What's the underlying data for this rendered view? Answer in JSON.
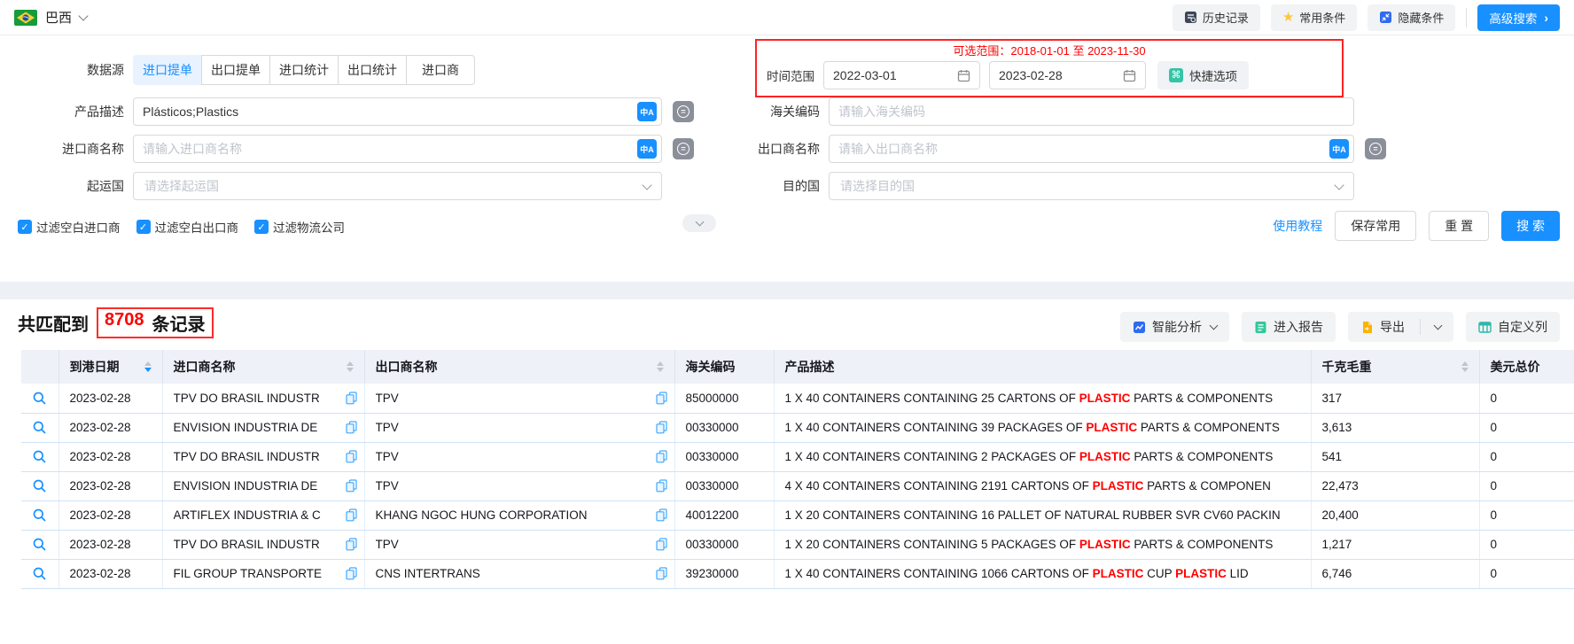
{
  "colors": {
    "accent": "#1890ff",
    "danger": "#ff0000",
    "highlight": "#ff0000",
    "success": "#34c79a",
    "warning": "#ffb200"
  },
  "topbar": {
    "country": "巴西",
    "buttons": [
      {
        "name": "history-button",
        "label": "历史记录",
        "icon": "history-icon"
      },
      {
        "name": "favorite-conditions-button",
        "label": "常用条件",
        "icon": "star-icon"
      },
      {
        "name": "hide-conditions-button",
        "label": "隐藏条件",
        "icon": "hide-icon"
      },
      {
        "name": "advanced-search-button",
        "label": "高级搜索",
        "icon": null,
        "primary": true,
        "chevron": true,
        "divider_before": true
      }
    ]
  },
  "search": {
    "datasource_label": "数据源",
    "tabs": [
      {
        "label": "进口提单",
        "active": true
      },
      {
        "label": "出口提单",
        "active": false
      },
      {
        "label": "进口统计",
        "active": false
      },
      {
        "label": "出口统计",
        "active": false
      },
      {
        "label": "进口商",
        "active": false
      }
    ],
    "time_range": {
      "hint": "可选范围：2018-01-01 至 2023-11-30",
      "label": "时间范围",
      "start": "2022-03-01",
      "end": "2023-02-28",
      "quick_button": "快捷选项"
    },
    "fields": {
      "product_desc": {
        "label": "产品描述",
        "value": "Plásticos;Plastics"
      },
      "hs_code": {
        "label": "海关编码",
        "placeholder": "请输入海关编码"
      },
      "importer": {
        "label": "进口商名称",
        "placeholder": "请输入进口商名称"
      },
      "exporter": {
        "label": "出口商名称",
        "placeholder": "请输入出口商名称"
      },
      "origin_country": {
        "label": "起运国",
        "placeholder": "请选择起运国"
      },
      "dest_country": {
        "label": "目的国",
        "placeholder": "请选择目的国"
      }
    },
    "filters": [
      {
        "label": "过滤空白进口商",
        "checked": true
      },
      {
        "label": "过滤空白出口商",
        "checked": true
      },
      {
        "label": "过滤物流公司",
        "checked": true
      }
    ],
    "actions": {
      "tutorial": "使用教程",
      "save": "保存常用",
      "reset": "重 置",
      "search": "搜 索"
    }
  },
  "results": {
    "summary": {
      "prefix": "共匹配到",
      "count": "8708",
      "suffix": "条记录"
    },
    "toolbar": [
      {
        "name": "smart-analysis-button",
        "label": "智能分析",
        "icon": "analysis-icon",
        "chevron": true
      },
      {
        "name": "enter-report-button",
        "label": "进入报告",
        "icon": "report-icon"
      },
      {
        "name": "export-button",
        "label": "导出",
        "icon": "export-icon",
        "split": true
      },
      {
        "name": "custom-columns-button",
        "label": "自定义列",
        "icon": "columns-icon"
      }
    ],
    "table": {
      "columns": [
        {
          "label": "",
          "sortable": false
        },
        {
          "label": "到港日期",
          "sortable": true,
          "sorted": "desc"
        },
        {
          "label": "进口商名称",
          "sortable": true,
          "sorted": null
        },
        {
          "label": "出口商名称",
          "sortable": true,
          "sorted": null
        },
        {
          "label": "海关编码",
          "sortable": false
        },
        {
          "label": "产品描述",
          "sortable": false
        },
        {
          "label": "千克毛重",
          "sortable": true,
          "sorted": null
        },
        {
          "label": "美元总价",
          "sortable": false
        }
      ],
      "highlight_term": "PLASTIC",
      "rows": [
        {
          "date": "2023-02-28",
          "importer": "TPV DO BRASIL INDUSTR",
          "exporter": "TPV",
          "hs_code": "85000000",
          "description": "1 X 40 CONTAINERS CONTAINING 25 CARTONS OF PLASTIC PARTS & COMPONENTS",
          "weight": "317",
          "usd": "0"
        },
        {
          "date": "2023-02-28",
          "importer": "ENVISION INDUSTRIA DE",
          "exporter": "TPV",
          "hs_code": "00330000",
          "description": "1 X 40 CONTAINERS CONTAINING 39 PACKAGES OF PLASTIC PARTS & COMPONENTS",
          "weight": "3,613",
          "usd": "0"
        },
        {
          "date": "2023-02-28",
          "importer": "TPV DO BRASIL INDUSTR",
          "exporter": "TPV",
          "hs_code": "00330000",
          "description": "1 X 40 CONTAINERS CONTAINING 2 PACKAGES OF PLASTIC PARTS & COMPONENTS",
          "weight": "541",
          "usd": "0"
        },
        {
          "date": "2023-02-28",
          "importer": "ENVISION INDUSTRIA DE",
          "exporter": "TPV",
          "hs_code": "00330000",
          "description": "4 X 40 CONTAINERS CONTAINING 2191 CARTONS OF PLASTIC PARTS & COMPONEN",
          "weight": "22,473",
          "usd": "0"
        },
        {
          "date": "2023-02-28",
          "importer": "ARTIFLEX INDUSTRIA & C",
          "exporter": "KHANG NGOC HUNG CORPORATION",
          "hs_code": "40012200",
          "description": "1 X 20 CONTAINERS CONTAINING 16 PALLET OF NATURAL RUBBER SVR CV60 PACKIN",
          "weight": "20,400",
          "usd": "0"
        },
        {
          "date": "2023-02-28",
          "importer": "TPV DO BRASIL INDUSTR",
          "exporter": "TPV",
          "hs_code": "00330000",
          "description": "1 X 20 CONTAINERS CONTAINING 5 PACKAGES OF PLASTIC PARTS & COMPONENTS",
          "weight": "1,217",
          "usd": "0"
        },
        {
          "date": "2023-02-28",
          "importer": "FIL GROUP TRANSPORTE",
          "exporter": "CNS INTERTRANS",
          "hs_code": "39230000",
          "description": "1 X 40 CONTAINERS CONTAINING 1066 CARTONS OF PLASTIC CUP PLASTIC LID",
          "weight": "6,746",
          "usd": "0"
        }
      ]
    }
  }
}
